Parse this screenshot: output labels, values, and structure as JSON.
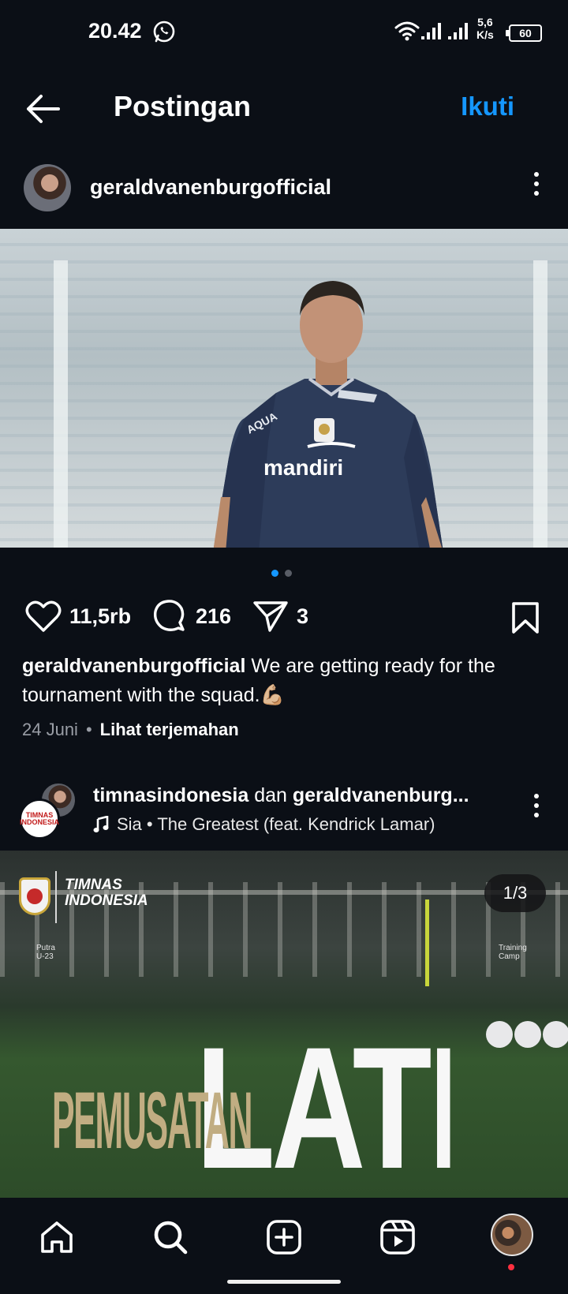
{
  "status_bar": {
    "time": "20.42",
    "network_speed_value": "5,6",
    "network_speed_unit": "K/s",
    "battery_level": "60"
  },
  "top_bar": {
    "title": "Postingan",
    "follow_label": "Ikuti"
  },
  "post": {
    "username": "geraldvanenburgofficial",
    "likes": "11,5rb",
    "comments": "216",
    "shares": "3",
    "caption_user": "geraldvanenburgofficial",
    "caption_text": " We are getting ready for the tournament with the squad.💪🏼",
    "date": "24 Juni",
    "separator": "•",
    "translate_label": "Lihat terjemahan",
    "carousel_dots": 2,
    "carousel_active": 1
  },
  "next_post": {
    "user_one": "timnasindonesia",
    "joiner": " dan ",
    "user_two": "geraldvanenburg...",
    "music": "Sia • The Greatest (feat. Kendrick Lamar)",
    "page_counter": "1/3",
    "brand_line1": "TIMNAS",
    "brand_line2": "INDONESIA",
    "label_left_1": "Putra",
    "label_left_2": "U-23",
    "label_right_1": "Training",
    "label_right_2": "Camp",
    "headline_small": "PEMUSATAN",
    "headline_big": "LATIHAN",
    "avatar_badge": "TIMNAS INDONESIA"
  },
  "bottom_nav": {
    "items": [
      "home-icon",
      "search-icon",
      "create-post-icon",
      "reels-icon",
      "profile-avatar"
    ]
  },
  "colors": {
    "background": "#0b0f16",
    "accent": "#1597ff",
    "gold": "#c1ad82"
  }
}
